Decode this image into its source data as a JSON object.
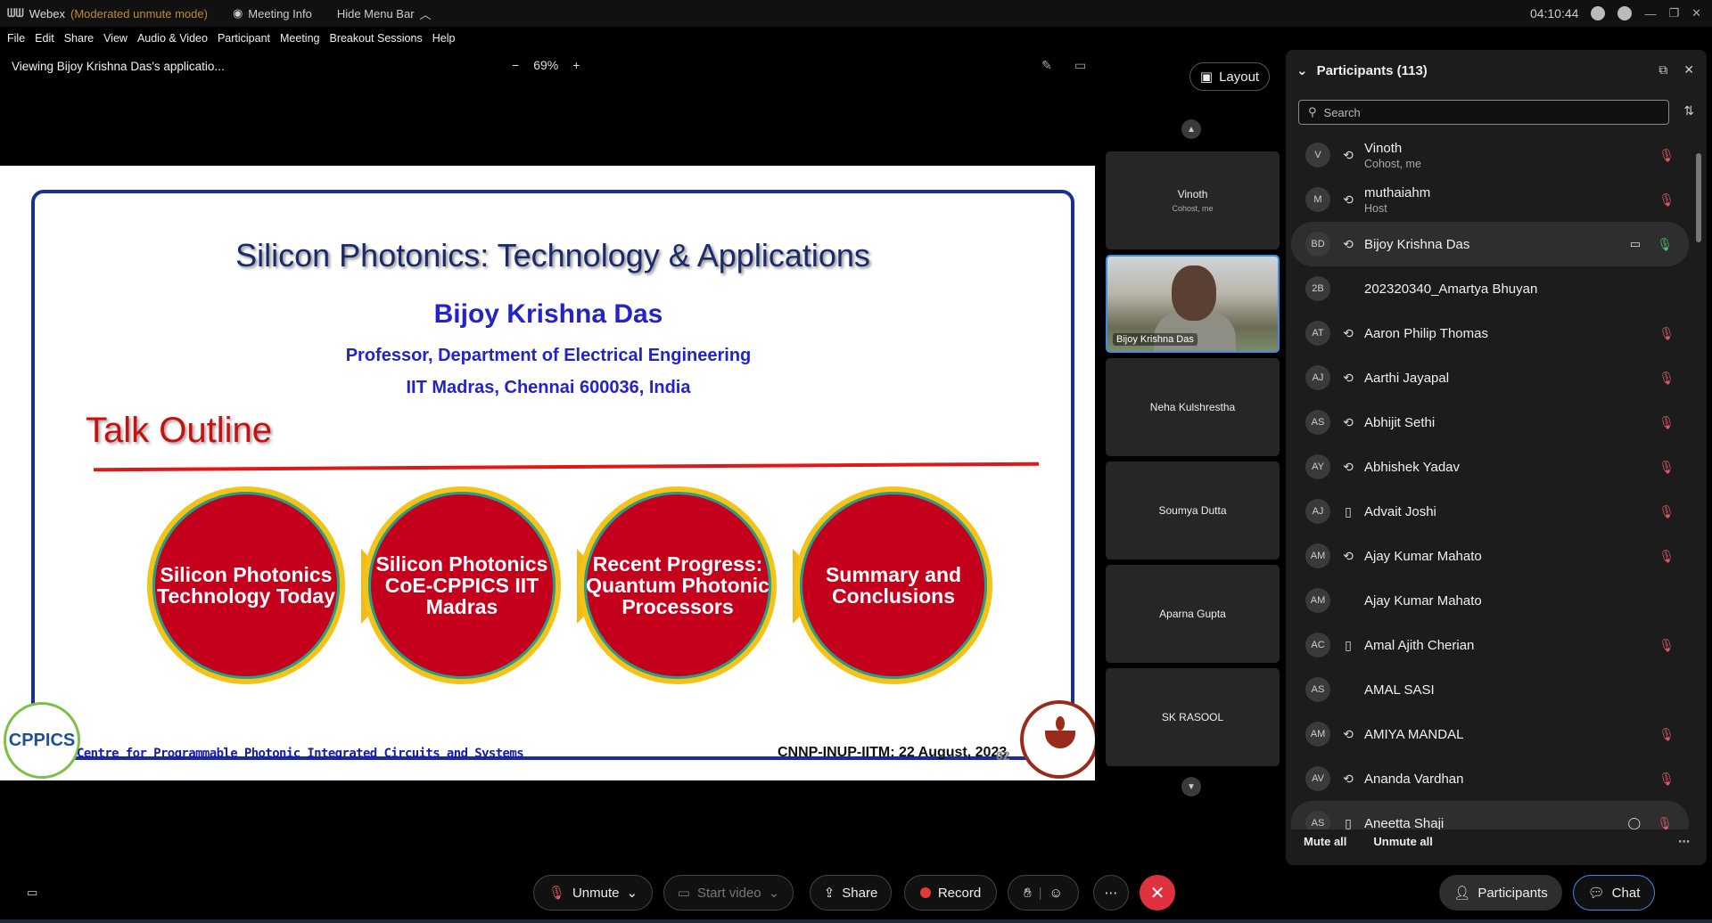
{
  "titlebar": {
    "app_name": "Webex",
    "mode": "(Moderated unmute mode)",
    "meeting_info": "Meeting Info",
    "hide_menu": "Hide Menu Bar",
    "clock": "04:10:44"
  },
  "menu": [
    "File",
    "Edit",
    "Share",
    "View",
    "Audio & Video",
    "Participant",
    "Meeting",
    "Breakout Sessions",
    "Help"
  ],
  "share_bar": {
    "viewing": "Viewing Bijoy Krishna Das's applicatio...",
    "zoom": "69%"
  },
  "slide": {
    "title": "Silicon Photonics: Technology & Applications",
    "author": "Bijoy Krishna Das",
    "dept": "Professor, Department of Electrical Engineering",
    "institute": "IIT Madras, Chennai 600036, India",
    "section": "Talk Outline",
    "circles": [
      "Silicon Photonics Technology Today",
      "Silicon Photonics CoE-CPPICS IIT Madras",
      "Recent Progress: Quantum Photonic Processors",
      "Summary and Conclusions"
    ],
    "footer_left": "Centre for Programmable Photonic Integrated Circuits and Systems",
    "footer_right": "CNNP-INUP-IITM: 22 August, 2023",
    "page_number": "02",
    "logo_left_text": "CPPICS"
  },
  "video": {
    "layout_label": "Layout",
    "tiles": [
      {
        "name": "Vinoth",
        "sub": "Cohost, me"
      },
      {
        "name": "Bijoy Krishna Das",
        "sub": ""
      },
      {
        "name": "Neha Kulshrestha",
        "sub": ""
      },
      {
        "name": "Soumya Dutta",
        "sub": ""
      },
      {
        "name": "Aparna Gupta",
        "sub": ""
      },
      {
        "name": "SK RASOOL",
        "sub": ""
      }
    ]
  },
  "participants": {
    "header": "Participants (113)",
    "search_placeholder": "Search",
    "list": [
      {
        "initials": "V",
        "name": "Vinoth",
        "role": "Cohost, me",
        "device": "headset",
        "mic": "muted",
        "video": "",
        "highlight": false
      },
      {
        "initials": "M",
        "name": "muthaiahm",
        "role": "Host",
        "device": "headset",
        "mic": "muted",
        "video": "",
        "highlight": false
      },
      {
        "initials": "BD",
        "name": "Bijoy Krishna Das",
        "role": "",
        "device": "headset",
        "mic": "on",
        "video": "video",
        "highlight": true
      },
      {
        "initials": "2B",
        "name": "202320340_Amartya Bhuyan",
        "role": "",
        "device": "",
        "mic": "",
        "video": "",
        "highlight": false
      },
      {
        "initials": "AT",
        "name": "Aaron Philip Thomas",
        "role": "",
        "device": "headset",
        "mic": "muted",
        "video": "",
        "highlight": false
      },
      {
        "initials": "AJ",
        "name": "Aarthi Jayapal",
        "role": "",
        "device": "headset",
        "mic": "muted",
        "video": "",
        "highlight": false
      },
      {
        "initials": "AS",
        "name": "Abhijit Sethi",
        "role": "",
        "device": "headset",
        "mic": "muted",
        "video": "",
        "highlight": false
      },
      {
        "initials": "AY",
        "name": "Abhishek Yadav",
        "role": "",
        "device": "headset",
        "mic": "muted",
        "video": "",
        "highlight": false
      },
      {
        "initials": "AJ",
        "name": "Advait Joshi",
        "role": "",
        "device": "phone",
        "mic": "muted",
        "video": "",
        "highlight": false
      },
      {
        "initials": "AM",
        "name": "Ajay Kumar Mahato",
        "role": "",
        "device": "headset",
        "mic": "muted",
        "video": "",
        "highlight": false
      },
      {
        "initials": "AM",
        "name": "Ajay Kumar Mahato",
        "role": "",
        "device": "",
        "mic": "",
        "video": "",
        "highlight": false
      },
      {
        "initials": "AC",
        "name": "Amal Ajith Cherian",
        "role": "",
        "device": "phone",
        "mic": "muted",
        "video": "",
        "highlight": false
      },
      {
        "initials": "AS",
        "name": "AMAL SASI",
        "role": "",
        "device": "",
        "mic": "",
        "video": "",
        "highlight": false
      },
      {
        "initials": "AM",
        "name": "AMIYA MANDAL",
        "role": "",
        "device": "headset",
        "mic": "muted",
        "video": "",
        "highlight": false
      },
      {
        "initials": "AV",
        "name": "Ananda Vardhan",
        "role": "",
        "device": "headset",
        "mic": "muted",
        "video": "",
        "highlight": false
      },
      {
        "initials": "AS",
        "name": "Aneetta Shaji",
        "role": "",
        "device": "phone",
        "mic": "muted",
        "video": "chat",
        "highlight": true
      }
    ],
    "mute_all": "Mute all",
    "unmute_all": "Unmute all"
  },
  "toolbar": {
    "unmute": "Unmute",
    "start_video": "Start video",
    "share": "Share",
    "record": "Record",
    "participants": "Participants",
    "chat": "Chat"
  },
  "colors": {
    "accent_blue": "#3d8de0",
    "mute_red": "#e05a6a",
    "leave_red": "#e0323e",
    "slide_red": "#c5001c",
    "slide_yellow": "#f2c41a"
  }
}
